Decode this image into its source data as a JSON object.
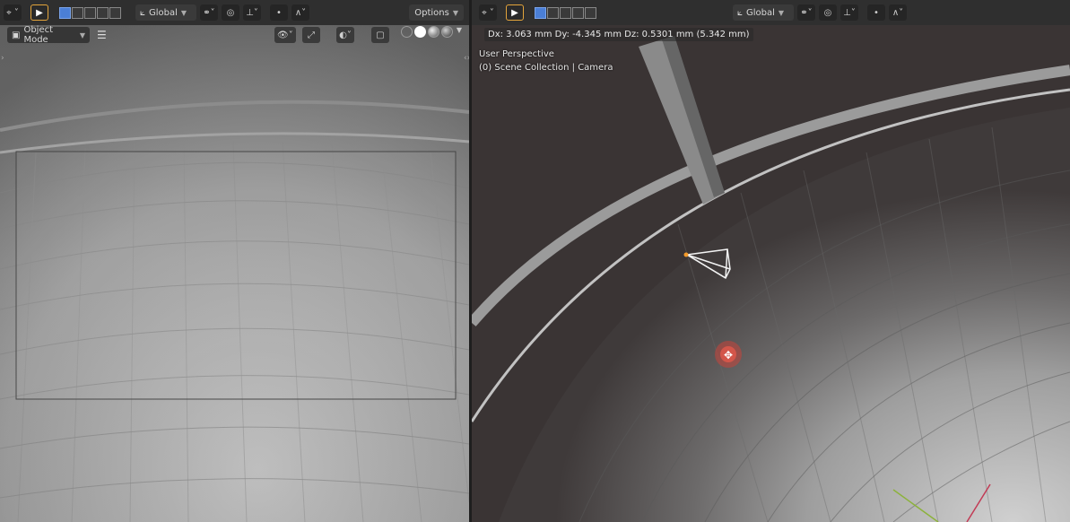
{
  "left_viewport": {
    "toolbar": {
      "transform_orientation": "Global",
      "options_label": "Options"
    },
    "mode": {
      "label": "Object Mode"
    }
  },
  "right_viewport": {
    "toolbar": {
      "transform_orientation": "Global"
    },
    "header_info": "Dx: 3.063 mm   Dy: -4.345 mm   Dz: 0.5301 mm (5.342 mm)",
    "view_name": "User Perspective",
    "collection_info": "(0) Scene Collection | Camera"
  },
  "colors": {
    "accent_active": "#e3a43b",
    "selection_blue": "#4b7fd6",
    "transform_gizmo": "#c8443a"
  }
}
